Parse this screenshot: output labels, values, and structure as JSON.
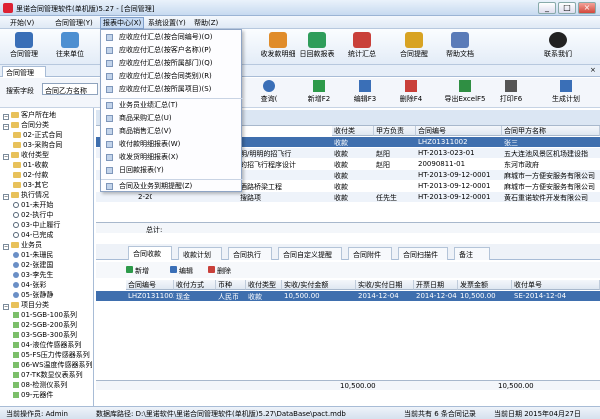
{
  "window": {
    "title": "里诺合同管理软件(单机版)5.27 - [合同管理]",
    "min": "_",
    "max": "□",
    "close": "×"
  },
  "menu": [
    "开始(V)",
    "合同管理(Y)",
    "报表中心(X)",
    "系统设置(Y)",
    "帮助(Z)"
  ],
  "toolbar": [
    {
      "label": "合同管理",
      "color": "#3a6fb7"
    },
    {
      "label": "往来单位",
      "color": "#4d8fd1"
    },
    {
      "label": "收发款明细",
      "color": "#e08c2a"
    },
    {
      "label": "日回款报表",
      "color": "#2f9d5b"
    },
    {
      "label": "统计汇总",
      "color": "#c9403a"
    },
    {
      "label": "合同提醒",
      "color": "#d8a323"
    },
    {
      "label": "帮助文档",
      "color": "#5a7bb8"
    },
    {
      "label": "联系我们",
      "color": "#222222"
    }
  ],
  "tab": {
    "label": "合同管理",
    "close": "×"
  },
  "search": {
    "field_label": "搜索字段",
    "field_value": "合同乙方名称"
  },
  "search_tools": [
    {
      "label": "查询(",
      "color": "#3a6fb7"
    },
    {
      "label": "新增F2",
      "color": "#2d9a4a"
    },
    {
      "label": "编辑F3",
      "color": "#3a6fb7"
    },
    {
      "label": "删除F4",
      "color": "#c9403a"
    },
    {
      "label": "导出ExcelF5",
      "color": "#2f8f43"
    },
    {
      "label": "打印F6",
      "color": "#555555"
    },
    {
      "label": "生成计划",
      "color": "#3a6fb7"
    }
  ],
  "dropdown": [
    "应收应付汇总(按合同编号)(O)",
    "应收应付汇总(按客户名称)(P)",
    "应收应付汇总(按所属部门)(Q)",
    "应收应付汇总(按合同类别)(R)",
    "应收应付汇总(按所属项目)(S)",
    "业务员业绩汇总(T)",
    "商品采购汇总(U)",
    "商品销售汇总(V)",
    "收付款明细报表(W)",
    "收发货明细报表(X)",
    "日回款报表(Y)",
    "合同及业务到期提醒(Z)"
  ],
  "tree": [
    {
      "t": "客户所在地",
      "lvl": 0,
      "k": "folder"
    },
    {
      "t": "合同分类",
      "lvl": 0,
      "k": "folder"
    },
    {
      "t": "02-正式合同",
      "lvl": 1,
      "k": "file"
    },
    {
      "t": "03-采购合同",
      "lvl": 1,
      "k": "file"
    },
    {
      "t": "收付类型",
      "lvl": 0,
      "k": "folder"
    },
    {
      "t": "01-收款",
      "lvl": 1,
      "k": "file"
    },
    {
      "t": "02-付款",
      "lvl": 1,
      "k": "file"
    },
    {
      "t": "03-其它",
      "lvl": 1,
      "k": "file"
    },
    {
      "t": "执行情况",
      "lvl": 0,
      "k": "folder"
    },
    {
      "t": "01-未开始",
      "lvl": 1,
      "k": "clock"
    },
    {
      "t": "02-执行中",
      "lvl": 1,
      "k": "clock"
    },
    {
      "t": "03-中止履行",
      "lvl": 1,
      "k": "clock"
    },
    {
      "t": "04-已完成",
      "lvl": 1,
      "k": "clock"
    },
    {
      "t": "业务员",
      "lvl": 0,
      "k": "folder"
    },
    {
      "t": "01-朱珊民",
      "lvl": 1,
      "k": "person"
    },
    {
      "t": "02-张建国",
      "lvl": 1,
      "k": "person"
    },
    {
      "t": "03-李先生",
      "lvl": 1,
      "k": "person"
    },
    {
      "t": "04-张彩",
      "lvl": 1,
      "k": "person"
    },
    {
      "t": "05-张静静",
      "lvl": 1,
      "k": "person"
    },
    {
      "t": "项目分类",
      "lvl": 0,
      "k": "folder"
    },
    {
      "t": "01-SGB-100系列",
      "lvl": 1,
      "k": "item"
    },
    {
      "t": "02-SGB-200系列",
      "lvl": 1,
      "k": "item"
    },
    {
      "t": "03-SGB-300系列",
      "lvl": 1,
      "k": "item"
    },
    {
      "t": "04-液位传感器系列",
      "lvl": 1,
      "k": "item"
    },
    {
      "t": "05-FS压力传感器系列",
      "lvl": 1,
      "k": "item"
    },
    {
      "t": "06-WS温度传感器系列",
      "lvl": 1,
      "k": "item"
    },
    {
      "t": "07-TK数显仪表系列",
      "lvl": 1,
      "k": "item"
    },
    {
      "t": "08-检测仪系列",
      "lvl": 1,
      "k": "item"
    },
    {
      "t": "09-元器件",
      "lvl": 1,
      "k": "item"
    }
  ],
  "grid": {
    "headers": [
      "收付类",
      "甲方负责",
      "合同编号",
      "合同甲方名称"
    ],
    "rows": [
      [
        "收款",
        "",
        "LHZ01311002",
        "张三"
      ],
      [
        "收款",
        "赵阳",
        "HT-2013-023-01",
        "五大连池风景区机场建设指"
      ],
      [
        "收款",
        "赵阳",
        "20090811-01",
        "东河市政府"
      ],
      [
        "收款",
        "",
        "HT-2013-09-12-0001",
        "麻城市一方便安服务有限公司"
      ],
      [
        "收款",
        "",
        "HT-2013-09-12-0001",
        "麻城市一方便安服务有限公司"
      ],
      [
        "收款",
        "任先生",
        "HT-2013-09-12-0001",
        "黄石重诺软件开发有限公司"
      ]
    ],
    "left_frags": [
      "",
      "明/明明的招飞行",
      "的招飞行程序设计",
      "",
      "酒路桥梁工程",
      "搜路项"
    ],
    "left_nums": [
      "",
      "",
      "",
      "",
      "",
      "2-2013-01-01"
    ],
    "total_label": "总计:"
  },
  "subtabs": [
    "合同收款",
    "收款计划",
    "合同执行",
    "合同自定义提醒",
    "合同附件",
    "合同扫描件",
    "备注"
  ],
  "subtools": [
    "新增",
    "编辑",
    "删除"
  ],
  "subgrid": {
    "headers": [
      "合同编号",
      "收付方式",
      "币种",
      "收付类型",
      "实收/实付金额",
      "实收/实付日期",
      "开票日期",
      "发票金额",
      "收付单号"
    ],
    "row": [
      "LHZ01311002",
      "现金",
      "人民币",
      "收款",
      "10,500.00",
      "2014-12-04",
      "2014-12-04",
      "10,500.00",
      "SE-2014-12-04"
    ],
    "total": "10,500.00"
  },
  "status": {
    "operator": "当前操作员: Admin",
    "db": "数据库路径: D:\\里诺软件\\里诺合同管理软件(单机版)5.27\\DataBase\\pact.mdb",
    "count": "当前共有 6 条合同记录",
    "date": "当前日期 2015年04月27日"
  }
}
